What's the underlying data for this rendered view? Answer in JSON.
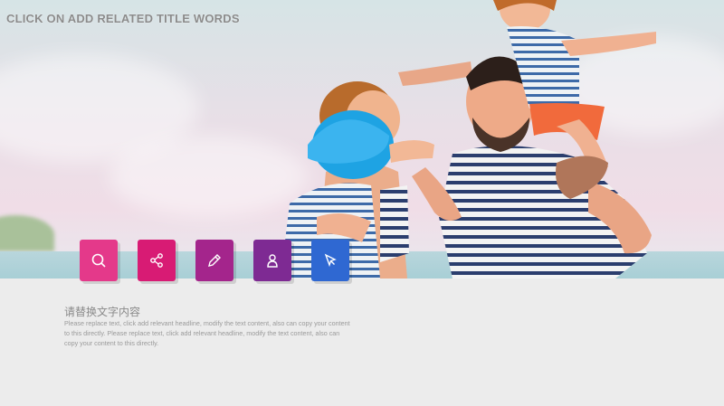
{
  "slide": {
    "title": "CLICK ON ADD RELATED TITLE WORDS",
    "content_title": "请替换文字内容",
    "content_text": "Please replace text, click add relevant headline, modify the text content, also can copy your content to this directly. Please replace text, click add relevant headline, modify the text content, also can copy your content to this directly."
  },
  "icons": [
    {
      "name": "search-icon",
      "color": "#e4398a"
    },
    {
      "name": "share-icon",
      "color": "#d81b74"
    },
    {
      "name": "edit-icon",
      "color": "#a4258c"
    },
    {
      "name": "user-icon",
      "color": "#7e2a93"
    },
    {
      "name": "cursor-icon",
      "color": "#2f68d2"
    }
  ]
}
